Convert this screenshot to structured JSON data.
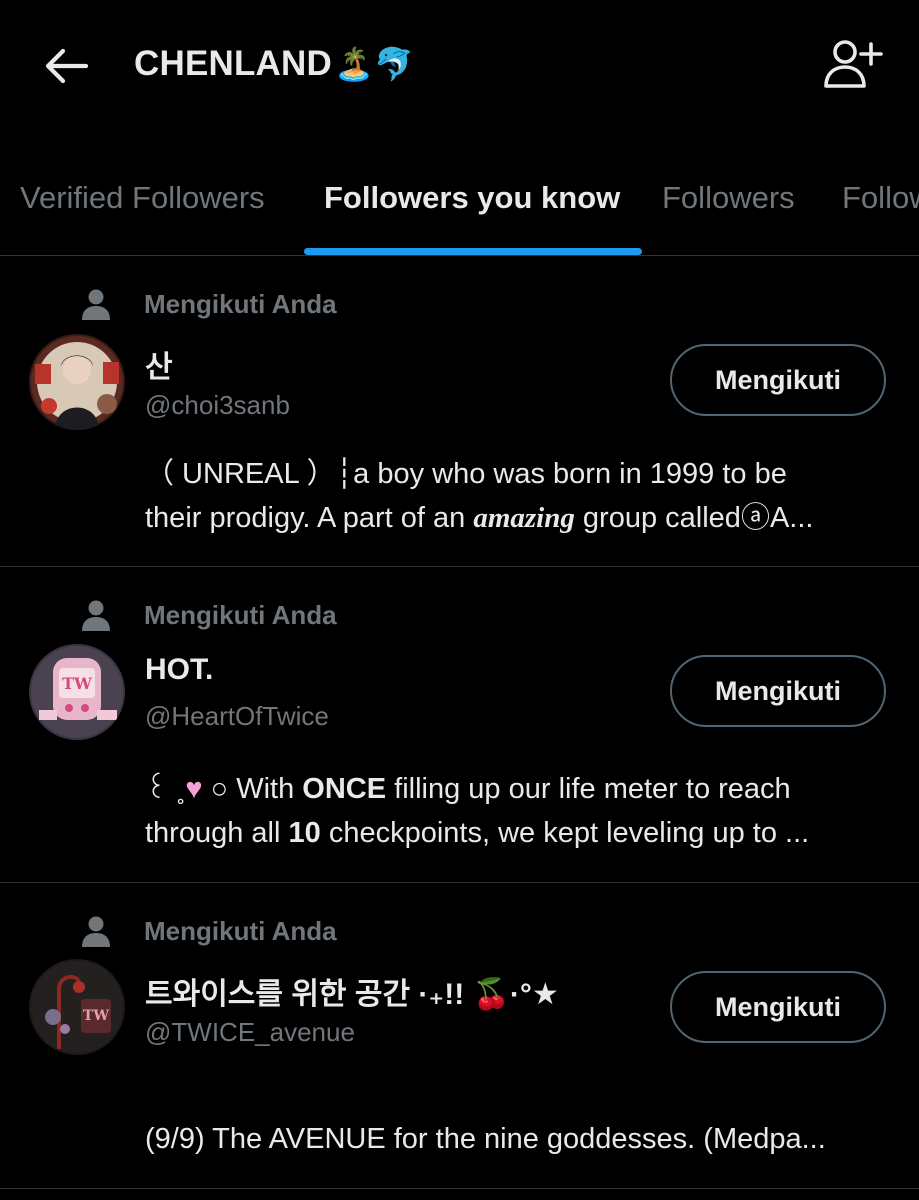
{
  "header": {
    "title": "CHENLAND",
    "title_emoji": "🏝️🐬"
  },
  "tabs": [
    {
      "label": "Verified Followers",
      "active": false
    },
    {
      "label": "Followers you know",
      "active": true
    },
    {
      "label": "Followers",
      "active": false
    },
    {
      "label": "Following",
      "active": false
    }
  ],
  "colors": {
    "background": "#000000",
    "accent": "#1d9bf0",
    "text_primary": "#e7e9ea",
    "text_secondary": "#71767b"
  },
  "users": [
    {
      "follows_you_label": "Mengikuti Anda",
      "display_name": "산",
      "handle": "@choi3sanb",
      "button_label": "Mengikuti",
      "bio_line1_a": "（ UNREAL ）┆a boy who was born in 1999 to be",
      "bio_line2_a": "their prodigy. A part of an ",
      "bio_line2_b": "amazing",
      "bio_line2_c": " group called",
      "bio_line2_d": "ⓐ⁠A..."
    },
    {
      "follows_you_label": "Mengikuti Anda",
      "display_name": "HOT.",
      "handle": "@HeartOfTwice",
      "button_label": "Mengikuti",
      "bio_line1_a": "꒰ ˳",
      "bio_line1_heart": "♥",
      "bio_line1_b": "○ With ",
      "bio_line1_c": "ONCE",
      "bio_line1_d": " filling up our life meter to reach",
      "bio_line2_a": "through all ",
      "bio_line2_b": "10",
      "bio_line2_c": " checkpoints, we kept leveling up to ..."
    },
    {
      "follows_you_label": "Mengikuti Anda",
      "display_name": "트와이스를 위한 공간 ·₊!! 🍒·°★",
      "handle": "@TWICE_avenue",
      "button_label": "Mengikuti",
      "bio_line1_a": "(9/9) The AVENUE for the nine goddesses. (Medpa..."
    }
  ]
}
